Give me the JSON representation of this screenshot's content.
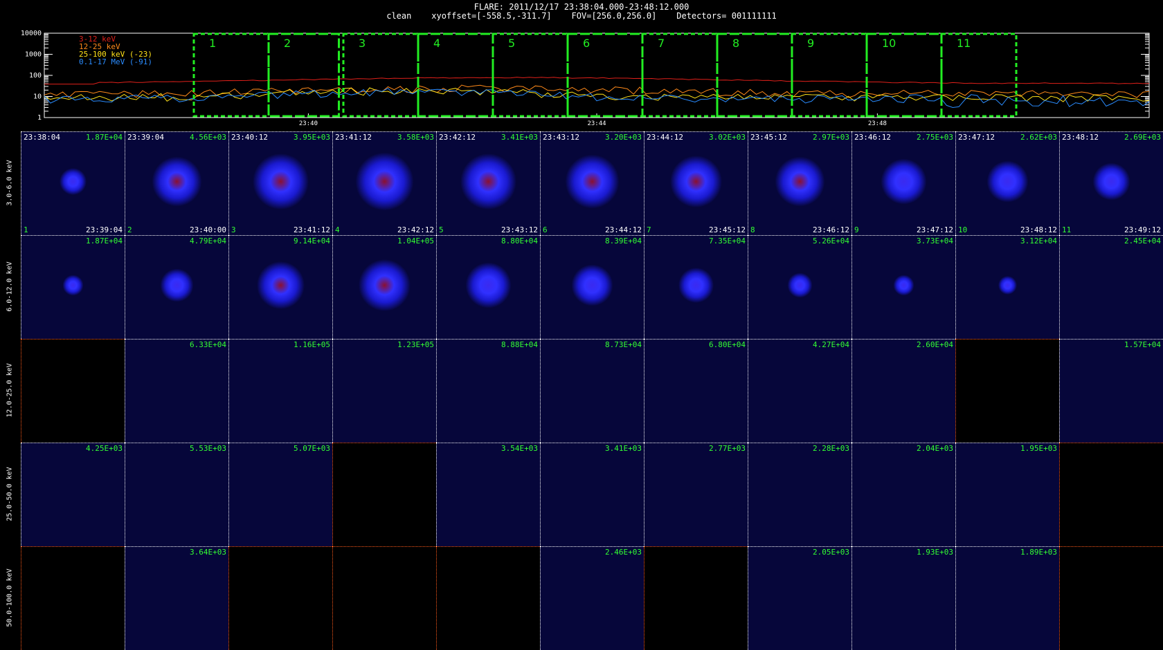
{
  "header": {
    "line1": "FLARE: 2011/12/17 23:38:04.000-23:48:12.000",
    "line2": "clean    xyoffset=[-558.5,-311.7]    FOV=[256.0,256.0]    Detectors= 001111111"
  },
  "chart_data": [
    {
      "type": "line",
      "ylim": [
        1,
        10000
      ],
      "yscale": "log",
      "yticks": [
        "10000",
        "1000",
        "100",
        "10",
        "1"
      ],
      "xticks": [
        "23:40",
        "23:44",
        "23:48"
      ],
      "series": [
        {
          "name": "3-12 keV",
          "color": "#e0201a",
          "level": 55
        },
        {
          "name": "12-25 keV",
          "color": "#ff8a1a",
          "level": 14
        },
        {
          "name": "25-100 keV (-23)",
          "color": "#ffe21a",
          "level": 9
        },
        {
          "name": "0.1-17 MeV (-91)",
          "color": "#2a8cff",
          "level": 8
        }
      ],
      "intervals": [
        "1",
        "2",
        "3",
        "4",
        "5",
        "6",
        "7",
        "8",
        "9",
        "10",
        "11"
      ],
      "interval_color": "#22ee22"
    },
    {
      "type": "heatmap",
      "rows": [
        "3.0-6.0 keV",
        "6.0-12.0 keV",
        "12.0-25.0 keV",
        "25.0-50.0 keV",
        "50.0-100.0 keV"
      ],
      "start_times": [
        "23:38:04",
        "23:39:04",
        "23:40:12",
        "23:41:12",
        "23:42:12",
        "23:43:12",
        "23:44:12",
        "23:45:12",
        "23:46:12",
        "23:47:12",
        "23:48:12"
      ],
      "end_times": [
        "23:39:04",
        "23:40:00",
        "23:41:12",
        "23:42:12",
        "23:43:12",
        "23:44:12",
        "23:45:12",
        "23:46:12",
        "23:47:12",
        "23:48:12",
        "23:49:12"
      ],
      "counts": [
        [
          "1.87E+04",
          "4.56E+03",
          "3.95E+03",
          "3.58E+03",
          "3.41E+03",
          "3.20E+03",
          "3.02E+03",
          "2.97E+03",
          "2.75E+03",
          "2.62E+03",
          "2.69E+03"
        ],
        [
          "1.87E+04",
          "4.79E+04",
          "9.14E+04",
          "1.04E+05",
          "8.80E+04",
          "8.39E+04",
          "7.35E+04",
          "5.26E+04",
          "3.73E+04",
          "3.12E+04",
          "2.45E+04"
        ],
        [
          "",
          "6.33E+04",
          "1.16E+05",
          "1.23E+05",
          "8.88E+04",
          "8.73E+04",
          "6.80E+04",
          "4.27E+04",
          "2.60E+04",
          "",
          "1.57E+04"
        ],
        [
          "4.25E+03",
          "5.53E+03",
          "5.07E+03",
          "",
          "3.54E+03",
          "3.41E+03",
          "2.77E+03",
          "2.28E+03",
          "2.04E+03",
          "1.95E+03",
          ""
        ],
        [
          "",
          "3.64E+03",
          "",
          "",
          "",
          "2.46E+03",
          "",
          "2.05E+03",
          "1.93E+03",
          "1.89E+03",
          ""
        ]
      ],
      "source_intensity": [
        [
          0.25,
          0.8,
          0.95,
          1.0,
          0.95,
          0.9,
          0.85,
          0.8,
          0.7,
          0.6,
          0.5
        ],
        [
          0.1,
          0.4,
          0.75,
          0.85,
          0.7,
          0.6,
          0.45,
          0.2,
          0.1,
          0.05,
          0
        ],
        [
          0,
          0,
          0,
          0,
          0,
          0,
          0,
          0,
          0,
          0,
          0
        ],
        [
          0,
          0,
          0,
          0,
          0,
          0,
          0,
          0,
          0,
          0,
          0
        ],
        [
          0,
          0,
          0,
          0,
          0,
          0,
          0,
          0,
          0,
          0,
          0
        ]
      ],
      "colors": {
        "background": "#06063a",
        "empty": "#000000",
        "count_text": "#33ff33",
        "grid": "#ffffff",
        "orange_axis": "#ff5a1a"
      }
    }
  ]
}
